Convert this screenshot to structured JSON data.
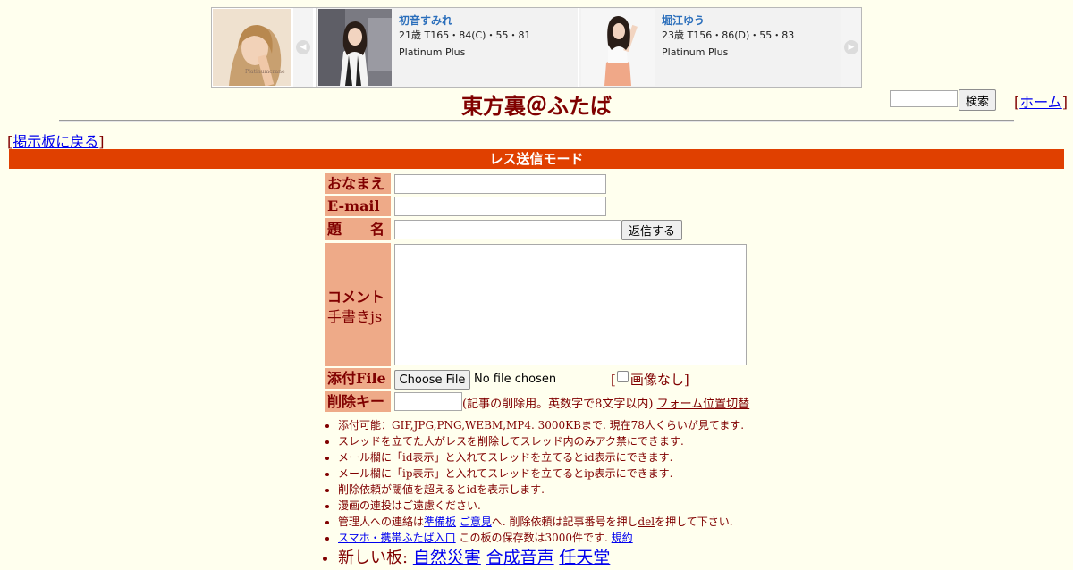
{
  "banner": {
    "thumb_caption": "Platinumcrane",
    "prev_arrow": "◀",
    "next_arrow": "▶",
    "cards": [
      {
        "name": "初音すみれ",
        "stats": "21歳 T165・84(C)・55・81",
        "plan": "Platinum Plus"
      },
      {
        "name": "堀江ゆう",
        "stats": "23歳 T156・86(D)・55・83",
        "plan": "Platinum Plus"
      }
    ]
  },
  "header": {
    "title": "東方裏＠ふたば",
    "search_button": "検索",
    "home_link": "ホーム",
    "back_link": "掲示板に戻る"
  },
  "mode_bar": "レス送信モード",
  "form": {
    "name_label": "おなまえ",
    "email_label": "E-mail",
    "subject_label": "題　　名",
    "submit_button": "返信する",
    "comment_label": "コメント",
    "handwrite_link": "手書きjs",
    "file_label": "添付File",
    "file_button": "Choose File",
    "no_file": "No file chosen",
    "no_image_label": "画像なし",
    "delkey_label": "削除キー",
    "delkey_note": "(記事の削除用。英数字で8文字以内)",
    "form_position_link": "フォーム位置切替"
  },
  "rules": {
    "r1": "添付可能：GIF,JPG,PNG,WEBM,MP4. 3000KBまで. 現在78人くらいが見てます.",
    "r2": "スレッドを立てた人がレスを削除してスレッド内のみアク禁にできます.",
    "r3": "メール欄に「id表示」と入れてスレッドを立てるとid表示にできます.",
    "r4": "メール欄に「ip表示」と入れてスレッドを立てるとip表示にできます.",
    "r5": "削除依頼が閾値を超えるとidを表示します.",
    "r6": "漫画の連投はご遠慮ください.",
    "r7_pre": "管理人への連絡は",
    "r7_link1": "準備板",
    "r7_link2": "ご意見",
    "r7_mid": "へ. 削除依頼は記事番号を押し",
    "r7_del": "del",
    "r7_post": "を押して下さい.",
    "r8_link": "スマホ・携帯ふたば入口",
    "r8_mid": " この板の保存数は3000件です.",
    "r8_link2": "規約",
    "r9_pre": "新しい板:",
    "r9_links": [
      "自然災害",
      "合成音声",
      "任天堂"
    ]
  },
  "colors": {
    "background": "#ffffee",
    "text": "#800000",
    "mode_bar": "#e04000",
    "label_bg": "#eeaa88",
    "link": "#0000ee"
  }
}
